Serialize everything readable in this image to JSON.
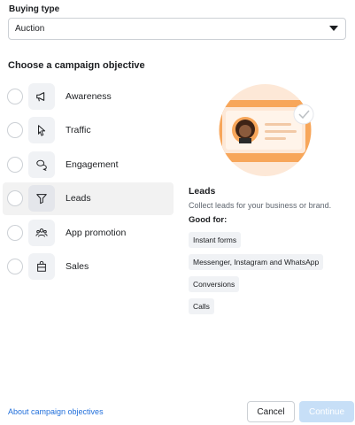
{
  "buying": {
    "label": "Buying type",
    "selected": "Auction"
  },
  "section_title": "Choose a campaign objective",
  "objectives": [
    {
      "label": "Awareness",
      "icon": "megaphone-icon"
    },
    {
      "label": "Traffic",
      "icon": "cursor-icon"
    },
    {
      "label": "Engagement",
      "icon": "chat-bubbles-icon"
    },
    {
      "label": "Leads",
      "icon": "funnel-icon",
      "selected": true
    },
    {
      "label": "App promotion",
      "icon": "people-icon"
    },
    {
      "label": "Sales",
      "icon": "shopping-bag-icon"
    }
  ],
  "detail": {
    "title": "Leads",
    "description": "Collect leads for your business or brand.",
    "good_for_label": "Good for:",
    "tags": [
      "Instant forms",
      "Messenger, Instagram and WhatsApp",
      "Conversions",
      "Calls"
    ]
  },
  "footer": {
    "link": "About campaign objectives",
    "cancel": "Cancel",
    "continue": "Continue"
  },
  "colors": {
    "accent_orange": "#f7a65a",
    "link_blue": "#216fdb",
    "continue_disabled": "#c7dff7"
  }
}
